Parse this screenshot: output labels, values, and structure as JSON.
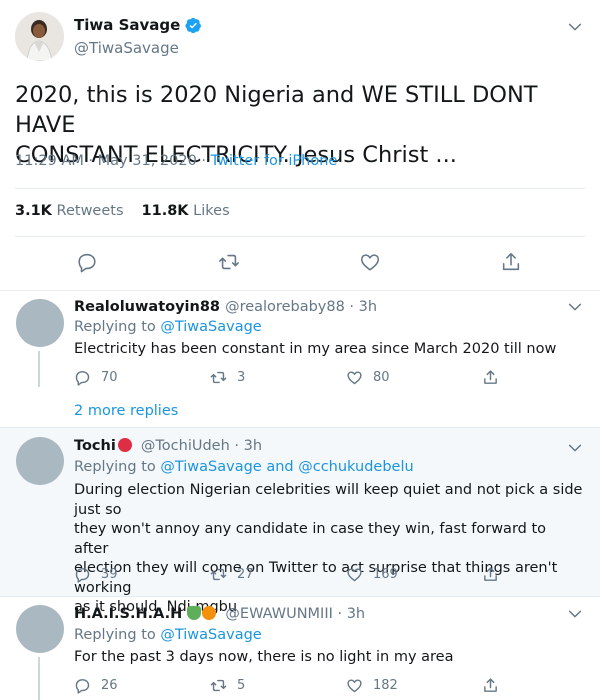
{
  "main_tweet": {
    "name": "Tiwa Savage",
    "handle": "@TiwaSavage",
    "text_line1": "2020, this is 2020 Nigeria and WE STILL DONT HAVE",
    "text_line2": "CONSTANT ELECTRICITY. Jesus Christ ...",
    "time": "11:29 AM · May 31, 2020 ·",
    "source": "Twitter for iPhone",
    "retweets_count": "3.1K",
    "retweets_label": "Retweets",
    "likes_count": "11.8K",
    "likes_label": "Likes"
  },
  "replies": [
    {
      "name": "Realoluwatoyin88",
      "handle": "@realorebaby88 · 3h",
      "replying_prefix": "Replying to",
      "replying_to": "@TiwaSavage",
      "text": "Electricity has been constant in my area since March 2020 till now",
      "reply_count": "70",
      "retweet_count": "3",
      "like_count": "80"
    },
    {
      "name": "Tochi",
      "handle": "@TochiUdeh · 3h",
      "replying_prefix": "Replying to",
      "replying_to": "@TiwaSavage",
      "replying_and": "and",
      "replying_to_2": "@cchukudebelu",
      "text_lines": [
        "During election Nigerian celebrities will keep quiet and not pick a side just so",
        "they won't annoy any candidate in case they win, fast forward to after",
        "election they will come on Twitter to act surprise that things aren't working",
        "as it should. Ndi mgbu"
      ],
      "reply_count": "39",
      "retweet_count": "27",
      "like_count": "169"
    },
    {
      "name": "H.A.I.S.H.A.H",
      "handle": "@EWAWUNMIII · 3h",
      "replying_prefix": "Replying to",
      "replying_to": "@TiwaSavage",
      "text": "For the past 3 days now, there is no light in my area",
      "reply_count": "26",
      "retweet_count": "5",
      "like_count": "182"
    }
  ],
  "more_replies": "2 more replies",
  "colors": {
    "accent": "#1b95e0",
    "muted": "#657786",
    "text": "#14171a",
    "highlight_bg": "#f5f8fa",
    "avatar": "#aab8c2"
  },
  "icons": [
    "verified-badge-icon",
    "chevron-down-icon",
    "reply-icon",
    "retweet-icon",
    "like-icon",
    "share-icon"
  ]
}
